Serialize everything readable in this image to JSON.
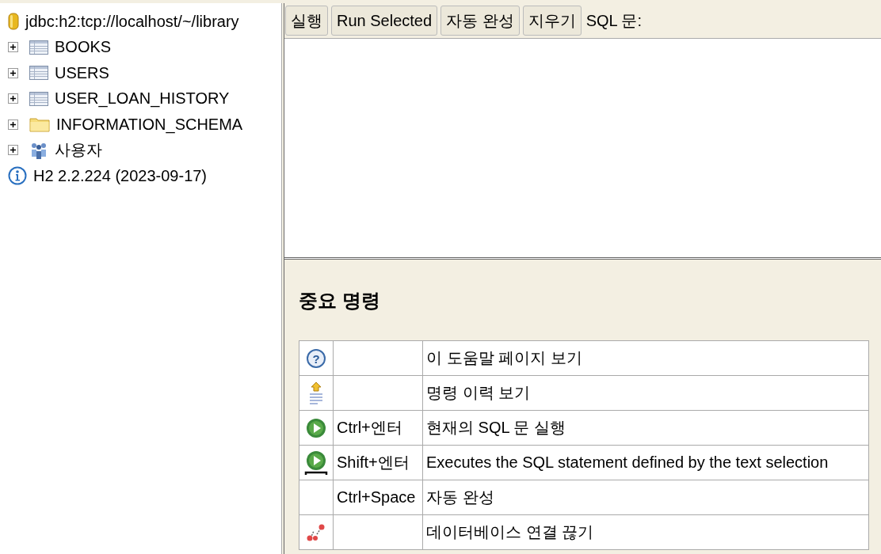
{
  "tree": {
    "root": {
      "label": "jdbc:h2:tcp://localhost/~/library"
    },
    "items": [
      {
        "kind": "table",
        "label": "BOOKS",
        "expanded": false
      },
      {
        "kind": "table",
        "label": "USERS",
        "expanded": false
      },
      {
        "kind": "table",
        "label": "USER_LOAN_HISTORY",
        "expanded": false
      },
      {
        "kind": "folder",
        "label": "INFORMATION_SCHEMA",
        "expanded": false
      },
      {
        "kind": "users",
        "label": "사용자",
        "expanded": false
      }
    ],
    "version": {
      "label": "H2 2.2.224 (2023-09-17)"
    }
  },
  "toolbar": {
    "buttons": [
      "실행",
      "Run Selected",
      "자동 완성",
      "지우기"
    ],
    "label": "SQL 문:"
  },
  "help": {
    "title": "중요 명령",
    "rows": [
      {
        "kind": "help",
        "glyph": "?",
        "description": "이 도움말 페이지 보기"
      },
      {
        "kind": "history",
        "description": "명령 이력 보기"
      },
      {
        "kind": "run",
        "keys": "Ctrl+엔터",
        "description": "현재의 SQL 문 실행"
      },
      {
        "kind": "run-selected",
        "keys": "Shift+엔터",
        "description": "Executes the SQL statement defined by the text selection"
      },
      {
        "kind": "plain",
        "keys": "Ctrl+Space",
        "description": "자동 완성"
      },
      {
        "kind": "disconnect",
        "description": "데이터베이스 연결 끊기"
      }
    ]
  }
}
